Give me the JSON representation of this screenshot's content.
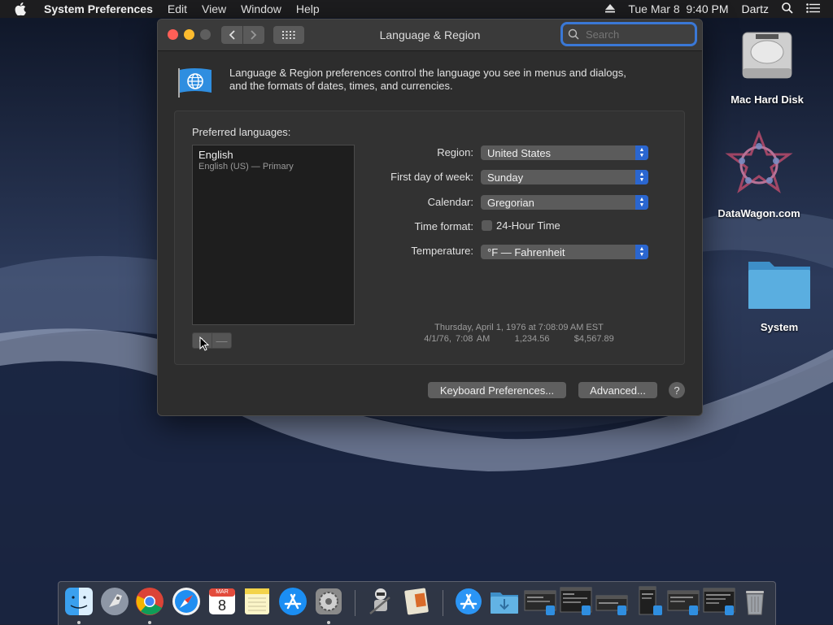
{
  "menubar": {
    "app_name": "System Preferences",
    "menus": [
      "Edit",
      "View",
      "Window",
      "Help"
    ],
    "datetime": "Tue Mar 8  9:40 PM",
    "user": "Dartz"
  },
  "desktop": {
    "icons": [
      {
        "label": "Mac Hard Disk"
      },
      {
        "label": "DataWagon.com"
      },
      {
        "label": "System"
      }
    ]
  },
  "window": {
    "title": "Language & Region",
    "search_placeholder": "Search",
    "intro_line1": "Language & Region preferences control the language you see in menus and dialogs,",
    "intro_line2": "and the formats of dates, times, and currencies.",
    "preferred_languages_label": "Preferred languages:",
    "languages": [
      {
        "name": "English",
        "detail": "English (US) — Primary"
      }
    ],
    "add_label": "+",
    "remove_label": "—",
    "settings": {
      "region_label": "Region:",
      "region_value": "United States",
      "first_day_label": "First day of week:",
      "first_day_value": "Sunday",
      "calendar_label": "Calendar:",
      "calendar_value": "Gregorian",
      "time_format_label": "Time format:",
      "time_format_option": "24-Hour Time",
      "time_format_checked": false,
      "temperature_label": "Temperature:",
      "temperature_value": "°F — Fahrenheit"
    },
    "sample_date": "Thursday, April 1, 1976 at 7:08:09 AM EST",
    "sample_formats": "4/1/76, 7:08 AM      1,234.56      $4,567.89",
    "keyboard_button": "Keyboard Preferences...",
    "advanced_button": "Advanced...",
    "help_button": "?"
  },
  "dock": {
    "apps": [
      "Finder",
      "Launchpad",
      "Chrome",
      "Safari",
      "Calendar",
      "Notes",
      "App Store",
      "System Preferences",
      "Automator",
      "Script Editor",
      "App Store Folder",
      "Downloads",
      "Window 1",
      "Window 2",
      "Window 3",
      "Window 4",
      "Window 5",
      "Window 6",
      "Trash"
    ],
    "calendar_month": "MAR",
    "calendar_day": "8"
  },
  "colors": {
    "accent": "#2a66d0",
    "close": "#fe5f57",
    "minimize": "#febc2e"
  }
}
